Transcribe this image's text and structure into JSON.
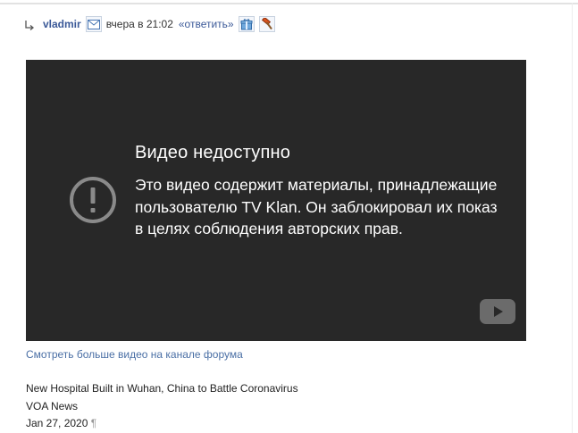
{
  "post": {
    "author": "vladmir",
    "date": "вчера в 21:02",
    "reply_label": "«ответить»",
    "icons": [
      "reply-arrow-icon",
      "mail-icon",
      "gift-icon",
      "hammer-icon"
    ]
  },
  "video": {
    "title": "Видео недоступно",
    "message": "Это видео содержит материалы, принадлежащие пользователю TV Klan. Он заблокировал их показ в целях соблюдения авторских прав.",
    "background": "#282828"
  },
  "more_link": "Смотреть больше видео на канале форума",
  "info": {
    "line1": "New Hospital Built in Wuhan, China to Battle Coronavirus",
    "line2": "VOA News",
    "line3": "Jan 27, 2020",
    "pilcrow": "¶"
  }
}
